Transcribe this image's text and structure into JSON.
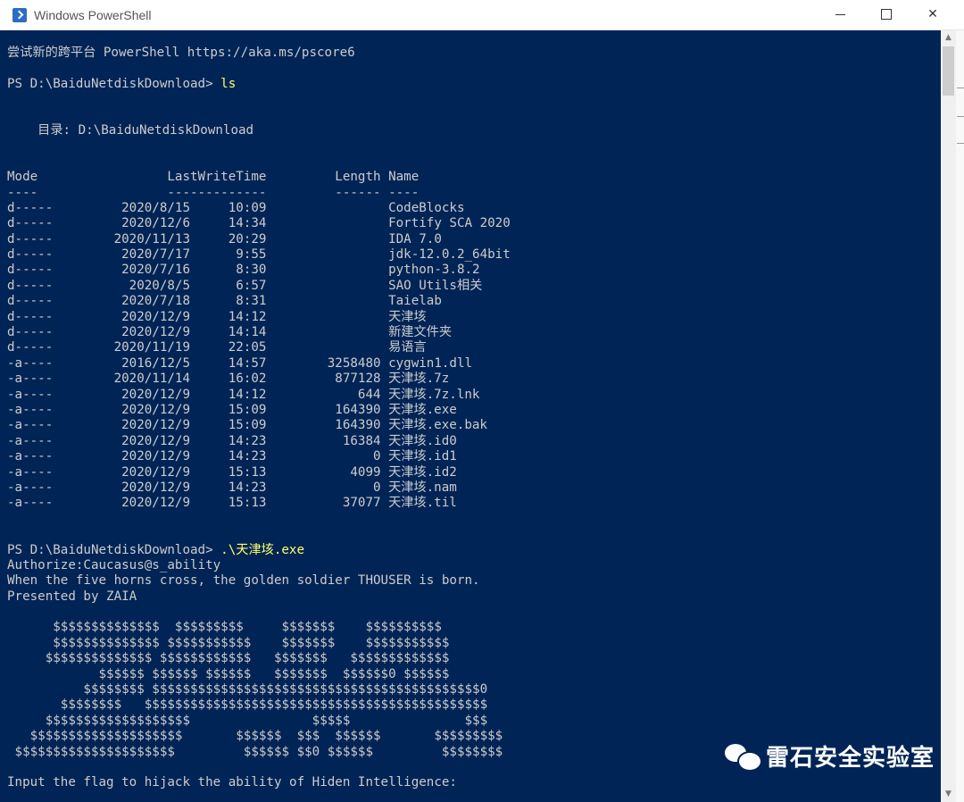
{
  "window": {
    "title": "Windows PowerShell"
  },
  "controls": {
    "minimize": "",
    "maximize": "",
    "close": "✕"
  },
  "console": {
    "lines": [
      "尝试新的跨平台 PowerShell https://aka.ms/pscore6",
      "",
      "PS D:\\BaiduNetdiskDownload> ls",
      "",
      "",
      "    目录: D:\\BaiduNetdiskDownload",
      "",
      "",
      "Mode                 LastWriteTime         Length Name",
      "----                 -------------         ------ ----",
      "d-----         2020/8/15     10:09                CodeBlocks",
      "d-----         2020/12/6     14:34                Fortify SCA 2020",
      "d-----        2020/11/13     20:29                IDA 7.0",
      "d-----         2020/7/17      9:55                jdk-12.0.2_64bit",
      "d-----         2020/7/16      8:30                python-3.8.2",
      "d-----          2020/8/5      6:57                SAO Utils相关",
      "d-----         2020/7/18      8:31                Taielab",
      "d-----         2020/12/9     14:12                天津垓",
      "d-----         2020/12/9     14:14                新建文件夹",
      "d-----        2020/11/19     22:05                易语言",
      "-a----         2016/12/5     14:57        3258480 cygwin1.dll",
      "-a----        2020/11/14     16:02         877128 天津垓.7z",
      "-a----         2020/12/9     14:12            644 天津垓.7z.lnk",
      "-a----         2020/12/9     15:09         164390 天津垓.exe",
      "-a----         2020/12/9     15:09         164390 天津垓.exe.bak",
      "-a----         2020/12/9     14:23          16384 天津垓.id0",
      "-a----         2020/12/9     14:23              0 天津垓.id1",
      "-a----         2020/12/9     15:13           4099 天津垓.id2",
      "-a----         2020/12/9     14:23              0 天津垓.nam",
      "-a----         2020/12/9     15:13          37077 天津垓.til",
      "",
      "",
      "PS D:\\BaiduNetdiskDownload> .\\天津垓.exe",
      "Authorize:Caucasus@s_ability",
      "When the five horns cross, the golden soldier THOUSER is born.",
      "Presented by ZAIA",
      "",
      "      $$$$$$$$$$$$$$  $$$$$$$$$     $$$$$$$    $$$$$$$$$$",
      "      $$$$$$$$$$$$$$ $$$$$$$$$$$    $$$$$$$    $$$$$$$$$$$",
      "     $$$$$$$$$$$$$$ $$$$$$$$$$$$   $$$$$$$   $$$$$$$$$$$$$",
      "            $$$$$$ $$$$$$ $$$$$$   $$$$$$$  $$$$$$0 $$$$$$",
      "          $$$$$$$$ $$$$$$$$$$$$$$$$$$$$$$$$$$$$$$$$$$$$$$$$$$$0",
      "       $$$$$$$$   $$$$$$$$$$$$$$$$$$$$$$$$$$$$$$$$$$$$$$$$$$$$$",
      "     $$$$$$$$$$$$$$$$$$$                $$$$$               $$$",
      "   $$$$$$$$$$$$$$$$$$$$       $$$$$$  $$$  $$$$$$       $$$$$$$$$",
      " $$$$$$$$$$$$$$$$$$$$$         $$$$$$ $$0 $$$$$$         $$$$$$$$",
      "",
      "Input the flag to hijack the ability of Hiden Intelligence:"
    ],
    "highlight": {
      "line": 32,
      "prefix": "PS D:\\BaiduNetdiskDownload> ",
      "command": ".\\天津垓.exe"
    },
    "highlight_ls": {
      "line": 2,
      "prefix": "PS D:\\BaiduNetdiskDownload> ",
      "command": "ls"
    }
  },
  "watermark": {
    "text": "雷石安全实验室"
  },
  "icons": [
    "powershell-icon",
    "minimize-icon",
    "maximize-icon",
    "close-icon",
    "wechat-icon"
  ]
}
